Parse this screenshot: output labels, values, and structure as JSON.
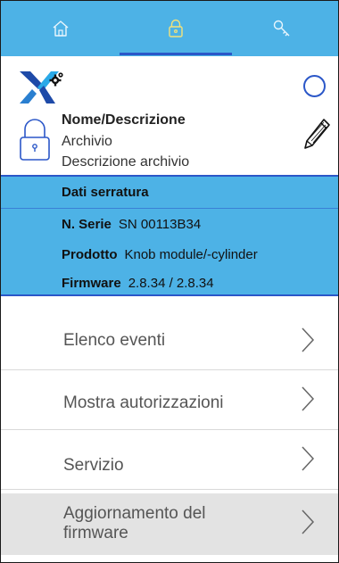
{
  "tabs": [
    {
      "name": "home-tab",
      "icon": "home-icon",
      "active": false
    },
    {
      "name": "lock-tab",
      "icon": "lock-icon",
      "active": true
    },
    {
      "name": "key-tab",
      "icon": "key-icon",
      "active": false
    }
  ],
  "colors": {
    "accent_blue": "#4db2e6",
    "highlight_blue": "#2b57c8",
    "menu_active_bg": "#e3e3e3"
  },
  "lock": {
    "title": "Nome/Descrizione",
    "line1": "Archivio",
    "line2": "Descrizione archivio"
  },
  "details": {
    "title": "Dati serratura",
    "serial_label": "N. Serie",
    "serial_value": "SN 00113B34",
    "product_label": "Prodotto",
    "product_value": "Knob module/-cylinder",
    "firmware_label": "Firmware",
    "firmware_value": "2.8.34 / 2.8.34"
  },
  "menu": [
    {
      "label": "Elenco eventi"
    },
    {
      "label": "Mostra autorizzazioni"
    },
    {
      "label": "Servizio"
    },
    {
      "label": "Aggiornamento del firmware",
      "label_line1": "Aggiornamento del",
      "label_line2": "firmware",
      "active": true
    }
  ]
}
